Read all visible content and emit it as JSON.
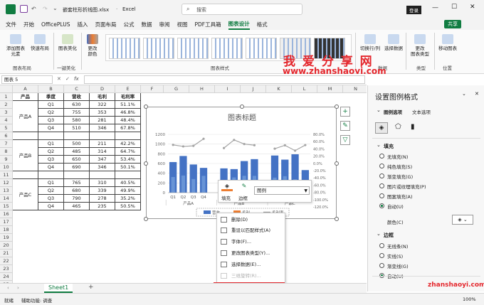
{
  "titlebar": {
    "autosave": "自动保存",
    "filename": "嵌套柱形折线图.xlsx",
    "app": "Excel",
    "search_placeholder": "搜索",
    "login_label": "登录"
  },
  "menu": [
    "文件",
    "开始",
    "OfficePLUS",
    "插入",
    "页面布局",
    "公式",
    "数据",
    "审阅",
    "视图",
    "PDF工具箱",
    "图表设计",
    "格式"
  ],
  "share_label": "共享",
  "ribbon": {
    "add_chart_element": "添加图表\n元素",
    "quick_layout": "快速布局",
    "beautify": "图表美化",
    "change_colors": "更改\n颜色",
    "switch_rowcol": "切换行/列",
    "select_data": "选择数据",
    "change_type": "更改\n图表类型",
    "move_chart": "移动图表",
    "group_layout": "图表布局",
    "group_beautify": "一键美化",
    "group_styles": "图表样式",
    "group_data": "数据",
    "group_type": "类型",
    "group_location": "位置"
  },
  "watermark": {
    "title": "我 爱 分 享 网",
    "url": "www.zhanshaoyi.com",
    "url2": "zhanshaoyi.com"
  },
  "formula": {
    "name_box": "图表 5",
    "fx": "fx"
  },
  "columns": [
    "A",
    "B",
    "C",
    "D",
    "E",
    "F",
    "G",
    "H",
    "I",
    "J",
    "K",
    "L",
    "M",
    "N"
  ],
  "rows": [
    "1",
    "2",
    "3",
    "4",
    "5",
    "6",
    "7",
    "8",
    "9",
    "10",
    "11",
    "12",
    "13",
    "14",
    "15",
    "16",
    "17",
    "18",
    "19",
    "20",
    "21",
    "22",
    "23",
    "24",
    "25"
  ],
  "table": {
    "headers": [
      "产品",
      "季度",
      "营收",
      "毛利",
      "毛利率"
    ],
    "groups": [
      {
        "product": "产品A",
        "rows": [
          [
            "Q1",
            "630",
            "322",
            "51.1%"
          ],
          [
            "Q2",
            "755",
            "353",
            "46.8%"
          ],
          [
            "Q3",
            "580",
            "281",
            "48.4%"
          ],
          [
            "Q4",
            "510",
            "346",
            "67.8%"
          ]
        ]
      },
      {
        "product": "产品B",
        "rows": [
          [
            "Q1",
            "500",
            "211",
            "42.2%"
          ],
          [
            "Q2",
            "485",
            "314",
            "64.7%"
          ],
          [
            "Q3",
            "650",
            "347",
            "53.4%"
          ],
          [
            "Q4",
            "690",
            "346",
            "50.1%"
          ]
        ]
      },
      {
        "product": "产品C",
        "rows": [
          [
            "Q1",
            "765",
            "310",
            "40.5%"
          ],
          [
            "Q2",
            "680",
            "339",
            "49.9%"
          ],
          [
            "Q3",
            "790",
            "278",
            "35.2%"
          ],
          [
            "Q4",
            "465",
            "235",
            "50.5%"
          ]
        ]
      }
    ]
  },
  "chart_data": {
    "type": "bar",
    "title": "图表标题",
    "categories": [
      "Q1",
      "Q2",
      "Q3",
      "Q4",
      "Q1",
      "Q2",
      "Q3",
      "Q4",
      "Q1",
      "Q2",
      "Q3",
      "Q4"
    ],
    "groups": [
      "产品A",
      "产品B",
      "产品C"
    ],
    "ylim": [
      0,
      1200
    ],
    "y_ticks": [
      "0",
      "200",
      "400",
      "600",
      "800",
      "1000",
      "1200"
    ],
    "y2_ticks": [
      "-120.0%",
      "-100.0%",
      "-80.0%",
      "-60.0%",
      "-40.0%",
      "-20.0%",
      "0.0%",
      "20.0%",
      "40.0%",
      "60.0%",
      "80.0%"
    ],
    "series": [
      {
        "name": "营收",
        "kind": "bar",
        "values": [
          630,
          755,
          580,
          510,
          500,
          485,
          650,
          690,
          765,
          680,
          790,
          465
        ],
        "color": "#4472c4"
      },
      {
        "name": "毛利",
        "kind": "bar",
        "values": [
          322,
          353,
          281,
          346,
          211,
          314,
          347,
          346,
          310,
          339,
          278,
          235
        ],
        "color": "#ed7d31"
      },
      {
        "name": "毛利率",
        "kind": "line",
        "values": [
          51.1,
          46.8,
          48.4,
          67.8,
          42.2,
          64.7,
          53.4,
          50.1,
          40.5,
          49.9,
          35.2,
          50.5
        ],
        "color": "#a5a5a5"
      }
    ]
  },
  "minitoolbar": {
    "fill": "填充",
    "outline": "边框",
    "dropdown": "图例"
  },
  "context_menu": [
    {
      "label": "删除(D)",
      "icon": "delete-icon",
      "disabled": false
    },
    {
      "label": "重设以匹配样式(A)",
      "icon": "reset-icon",
      "disabled": false
    },
    {
      "label": "字体(F)...",
      "icon": "font-icon",
      "disabled": false
    },
    {
      "label": "更改图表类型(Y)...",
      "icon": "chart-type-icon",
      "disabled": false
    },
    {
      "label": "选择数据(E)...",
      "icon": "select-data-icon",
      "disabled": false
    },
    {
      "label": "三维旋转(R)...",
      "icon": "rotate-3d-icon",
      "disabled": true
    },
    {
      "label": "设置图例格式(F)...",
      "icon": "format-legend-icon",
      "disabled": false
    }
  ],
  "pane": {
    "title": "设置图例格式",
    "tab_options": "图例选项",
    "tab_text": "文本选项",
    "fill_heading": "填充",
    "fill_options": [
      "无填充(N)",
      "纯色填充(S)",
      "渐变填充(G)",
      "图片或纹理填充(P)",
      "图案填充(A)",
      "自动(U)"
    ],
    "fill_selected": 5,
    "color_label": "颜色(C)",
    "border_heading": "边框",
    "border_options": [
      "无线条(N)",
      "实线(S)",
      "渐变线(G)",
      "自动(U)"
    ],
    "border_selected": 3
  },
  "sheet_tab": "Sheet1",
  "add_sheet": "+",
  "status": {
    "ready": "就绪",
    "accessibility": "辅助功能: 调查",
    "zoom": "100%"
  }
}
